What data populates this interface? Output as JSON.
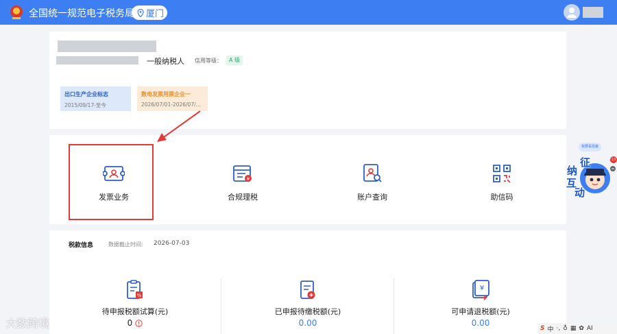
{
  "header": {
    "title": "全国统一规范电子税务局",
    "city": "厦门"
  },
  "profile": {
    "taxpayer_type": "一般纳税人",
    "credit_label": "信用等级：",
    "credit_grade": "A 级",
    "tags": [
      {
        "title": "出口生产企业标志",
        "sub": "2015/09/17-至今"
      },
      {
        "title": "数电发票用票企业一",
        "sub": "2026/07/01-2026/07/..."
      }
    ]
  },
  "menu": {
    "items": [
      {
        "label": "发票业务",
        "icon": "invoice-icon"
      },
      {
        "label": "合规理税",
        "icon": "compliance-icon"
      },
      {
        "label": "账户查询",
        "icon": "account-search-icon"
      },
      {
        "label": "助信码",
        "icon": "qr-code-icon"
      }
    ]
  },
  "tax_info": {
    "title": "税款信息",
    "date_label": "数据截止时间:",
    "date": "2026-07-03",
    "columns": [
      {
        "label": "待申报税额试算(元)",
        "value": "0"
      },
      {
        "label": "已申报待缴税额(元)",
        "value": "0.00"
      },
      {
        "label": "可申请退税额(元)",
        "value": "0.00"
      }
    ]
  },
  "assistant": {
    "bubble": "我要看政策",
    "badge": "10",
    "chars": [
      "征",
      "纳",
      "互",
      "动"
    ]
  },
  "watermark": "大数跨境",
  "tray": {
    "ime": "中",
    "ai": "AI"
  },
  "colors": {
    "brand": "#3d7ff2",
    "highlight": "#e53935",
    "credit_green": "#2fa86a",
    "tag_orange": "#e6902d"
  }
}
